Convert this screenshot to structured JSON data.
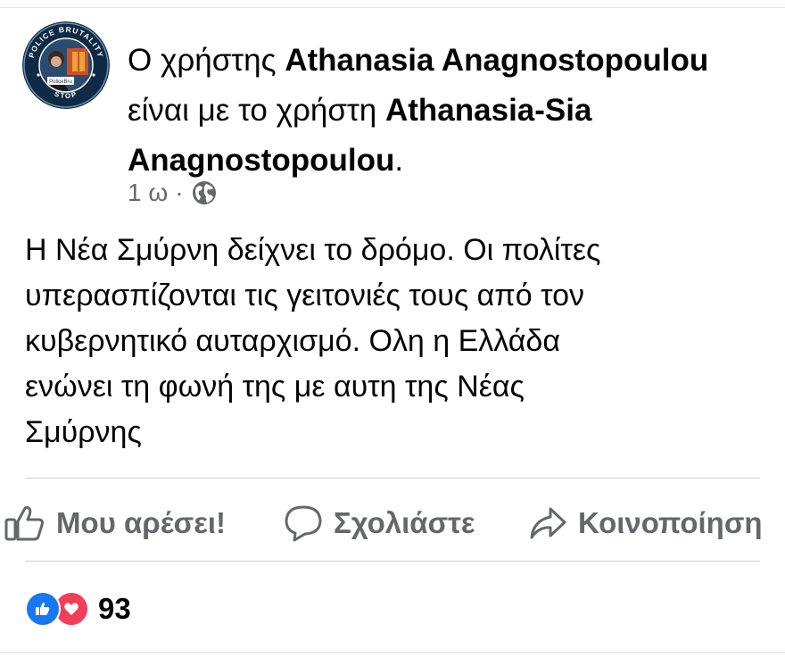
{
  "post": {
    "avatar": {
      "icon": "police-brutality-stop-badge-icon",
      "ring_text": "POLICE BRUTALITY",
      "ring_text_bottom": "STOP",
      "inner_label": "PoliceBru",
      "ring_color": "#0e2a45",
      "ring_text_color": "#ffffff"
    },
    "header": {
      "prefix": "Ο χρήστης",
      "author": "Athanasia Anagnostopoulou",
      "connector": "είναι με το χρήστη",
      "tagged_user": "Athanasia-Sia Anagnostopoulou",
      "suffix": "."
    },
    "meta": {
      "time": "1 ω",
      "separator": "·",
      "privacy_icon": "globe-icon"
    },
    "text": "Η Νέα Σμύρνη δείχνει το δρόμο.  Οι πολίτες\nυπερασπίζονται τις γειτονιές τους από τον\nκυβερνητικό αυταρχισμό.  Ολη η Ελλάδα\nενώνει τη φωνή της με αυτη της Νέας\nΣμύρνης"
  },
  "actions": {
    "like": {
      "label": "Μου αρέσει!",
      "icon": "thumbs-up-icon"
    },
    "comment": {
      "label": "Σχολιάστε",
      "icon": "comment-bubble-icon"
    },
    "share": {
      "label": "Κοινοποίηση",
      "icon": "share-arrow-icon"
    }
  },
  "reactions": {
    "types": [
      "like-reaction-icon",
      "love-reaction-icon"
    ],
    "count": "93",
    "like_color": "#1877f2",
    "love_color": "#f33e58"
  },
  "colors": {
    "text": "#050505",
    "secondary_text": "#65676b",
    "divider": "#ced0d4"
  }
}
